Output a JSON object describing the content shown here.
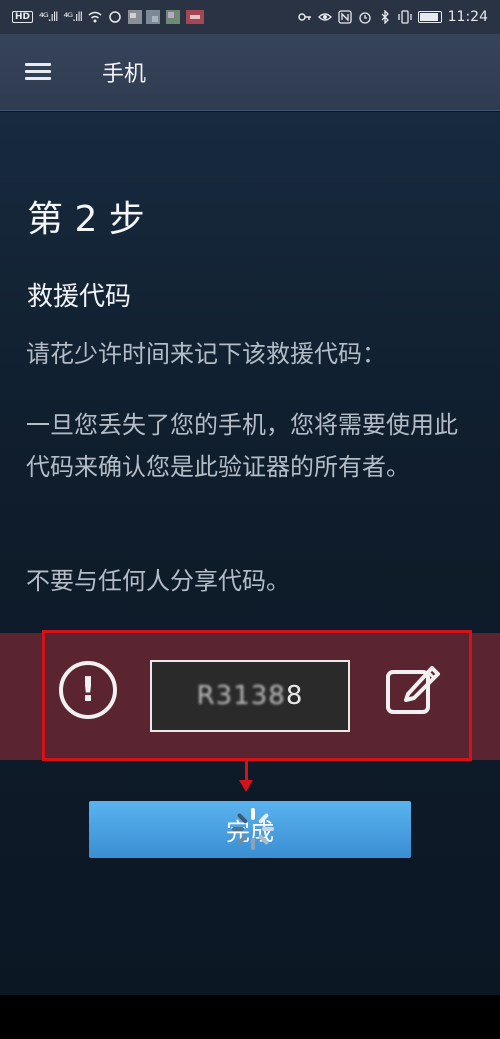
{
  "status_bar": {
    "network_tag": "HD",
    "signal1": "⁴ᴳ.ıll",
    "signal2": "⁴ᴳ.ıll",
    "time": "11:24",
    "status_icons": [
      "key-icon",
      "eye-icon",
      "nfc-icon",
      "alarm-icon",
      "bluetooth-icon",
      "vibrate-icon",
      "battery-icon"
    ]
  },
  "appbar": {
    "title": "手机"
  },
  "content": {
    "step_title": "第 2 步",
    "section_title": "救援代码",
    "paragraph1": "请花少许时间来记下该救援代码：",
    "paragraph2": "一旦您丢失了您的手机，您将需要使用此代码来确认您是此验证器的所有者。",
    "paragraph3": "不要与任何人分享代码。"
  },
  "code_strip": {
    "code_visible": "R3138",
    "code_last": "8",
    "warning_symbol": "!",
    "colors": {
      "strip": "#5a2430",
      "highlight": "#d3121a"
    }
  },
  "done_button": {
    "label": "完成"
  }
}
